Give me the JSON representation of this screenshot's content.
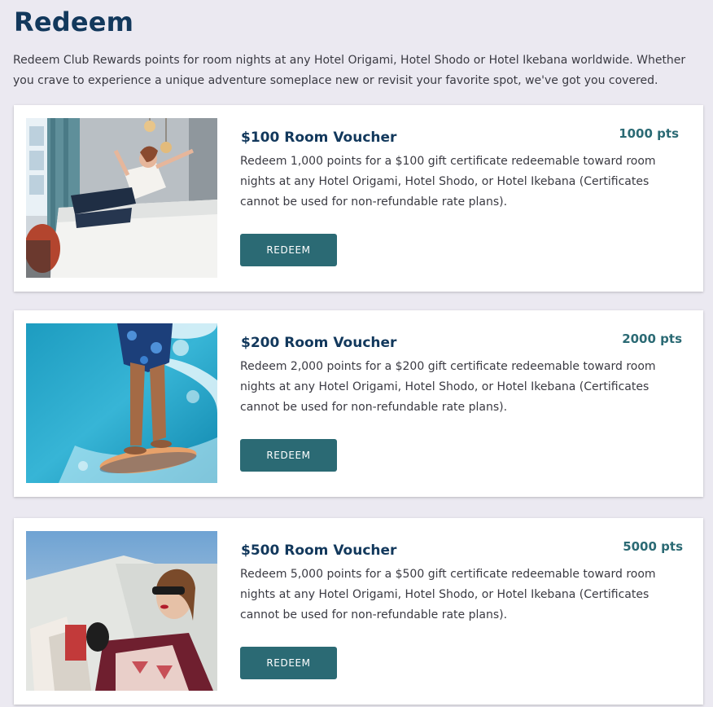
{
  "page": {
    "title": "Redeem",
    "intro": "Redeem Club Rewards points for room nights at any Hotel Origami, Hotel Shodo or Hotel Ikebana worldwide. Whether you crave to experience a unique adventure someplace new or revisit your favorite spot, we've got you covered."
  },
  "rewards": [
    {
      "title": "$100 Room Voucher",
      "points": "1000 pts",
      "description": "Redeem 1,000 points for a $100 gift certificate redeemable toward room nights at any Hotel Origami, Hotel Shodo, or Hotel Ikebana (Certificates cannot be used for non-refundable rate plans).",
      "button_label": "REDEEM",
      "image": "woman-jumping-on-hotel-bed-photo"
    },
    {
      "title": "$200 Room Voucher",
      "points": "2000 pts",
      "description": "Redeem 2,000 points for a $200 gift certificate redeemable toward room nights at any Hotel Origami, Hotel Shodo, or Hotel Ikebana (Certificates cannot be used for non-refundable rate plans).",
      "button_label": "REDEEM",
      "image": "surfer-on-wave-photo"
    },
    {
      "title": "$500 Room Voucher",
      "points": "5000 pts",
      "description": "Redeem 5,000 points for a $500 gift certificate redeemable toward room nights at any Hotel Origami, Hotel Shodo, or Hotel Ikebana (Certificates cannot be used for non-refundable rate plans).",
      "button_label": "REDEEM",
      "image": "woman-with-shopping-bags-photo"
    }
  ],
  "colors": {
    "background": "#ebe9f1",
    "title": "#12385c",
    "accent": "#2b6a74",
    "card": "#ffffff"
  }
}
